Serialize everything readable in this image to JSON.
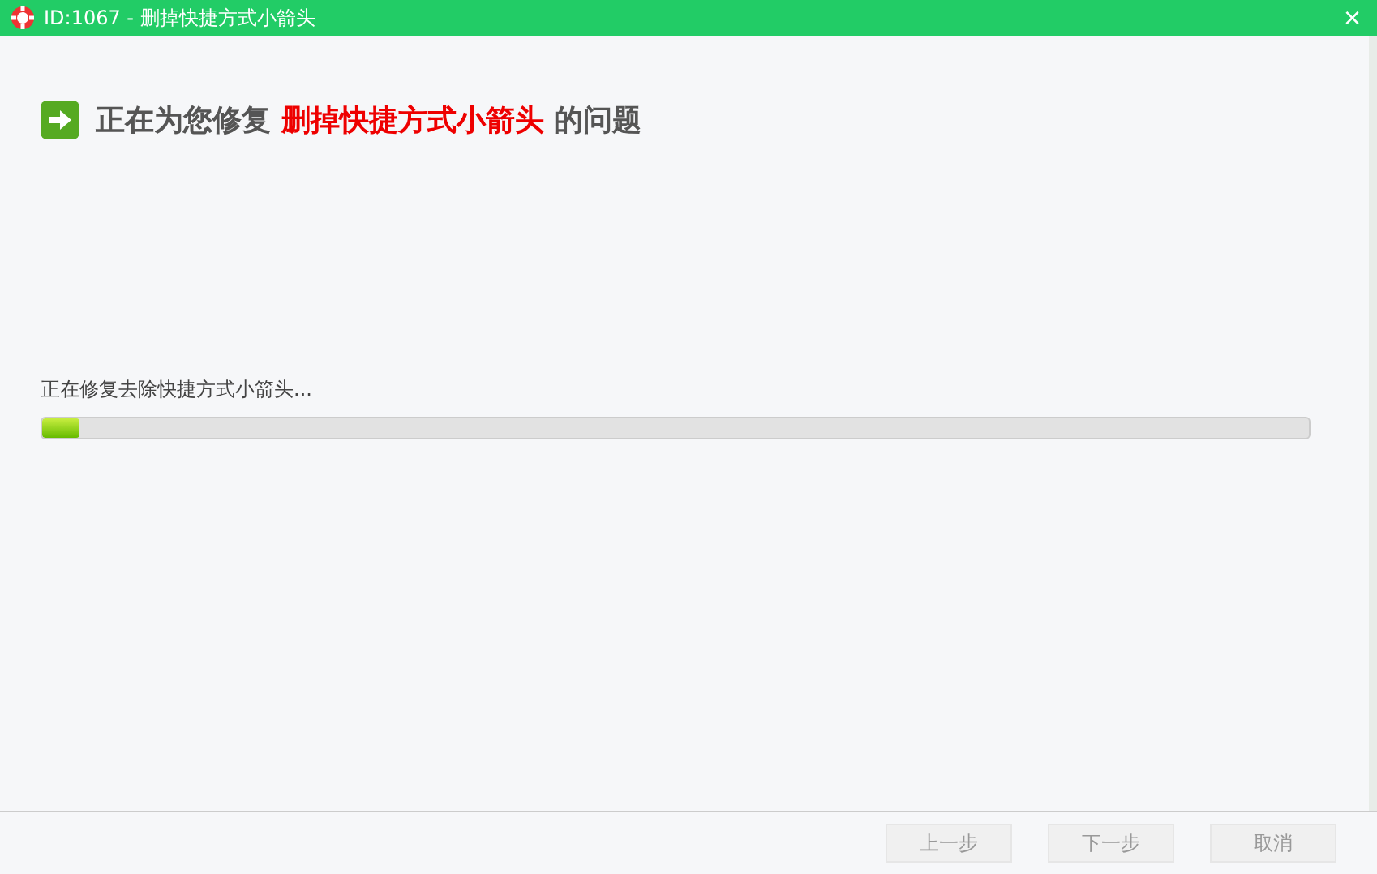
{
  "window": {
    "title": "ID:1067 - 删掉快捷方式小箭头",
    "close": "×"
  },
  "heading": {
    "prefix": "正在为您修复",
    "highlight": "删掉快捷方式小箭头",
    "suffix": "的问题"
  },
  "progress": {
    "label": "正在修复去除快捷方式小箭头...",
    "level": 0.03
  },
  "buttons": [
    {
      "label": "上一步",
      "disabled": true
    },
    {
      "label": "下一步",
      "disabled": true
    },
    {
      "label": "取消",
      "disabled": true
    }
  ]
}
